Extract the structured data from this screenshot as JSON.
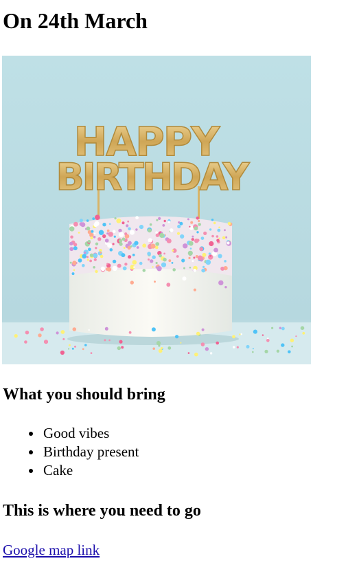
{
  "title": "On 24th March",
  "hero_image": {
    "topper_line1": "HAPPY",
    "topper_line2": "BIRTHDAY",
    "colors": {
      "background": "#bcdde3",
      "cake": "#f4f2ec",
      "gold": "#d8b468"
    }
  },
  "bring": {
    "heading": "What you should bring",
    "items": [
      "Good vibes",
      "Birthday present",
      "Cake"
    ]
  },
  "location": {
    "heading": "This is where you need to go",
    "link_text": "Google map link"
  },
  "colors": {
    "link": "#1a0dab"
  }
}
